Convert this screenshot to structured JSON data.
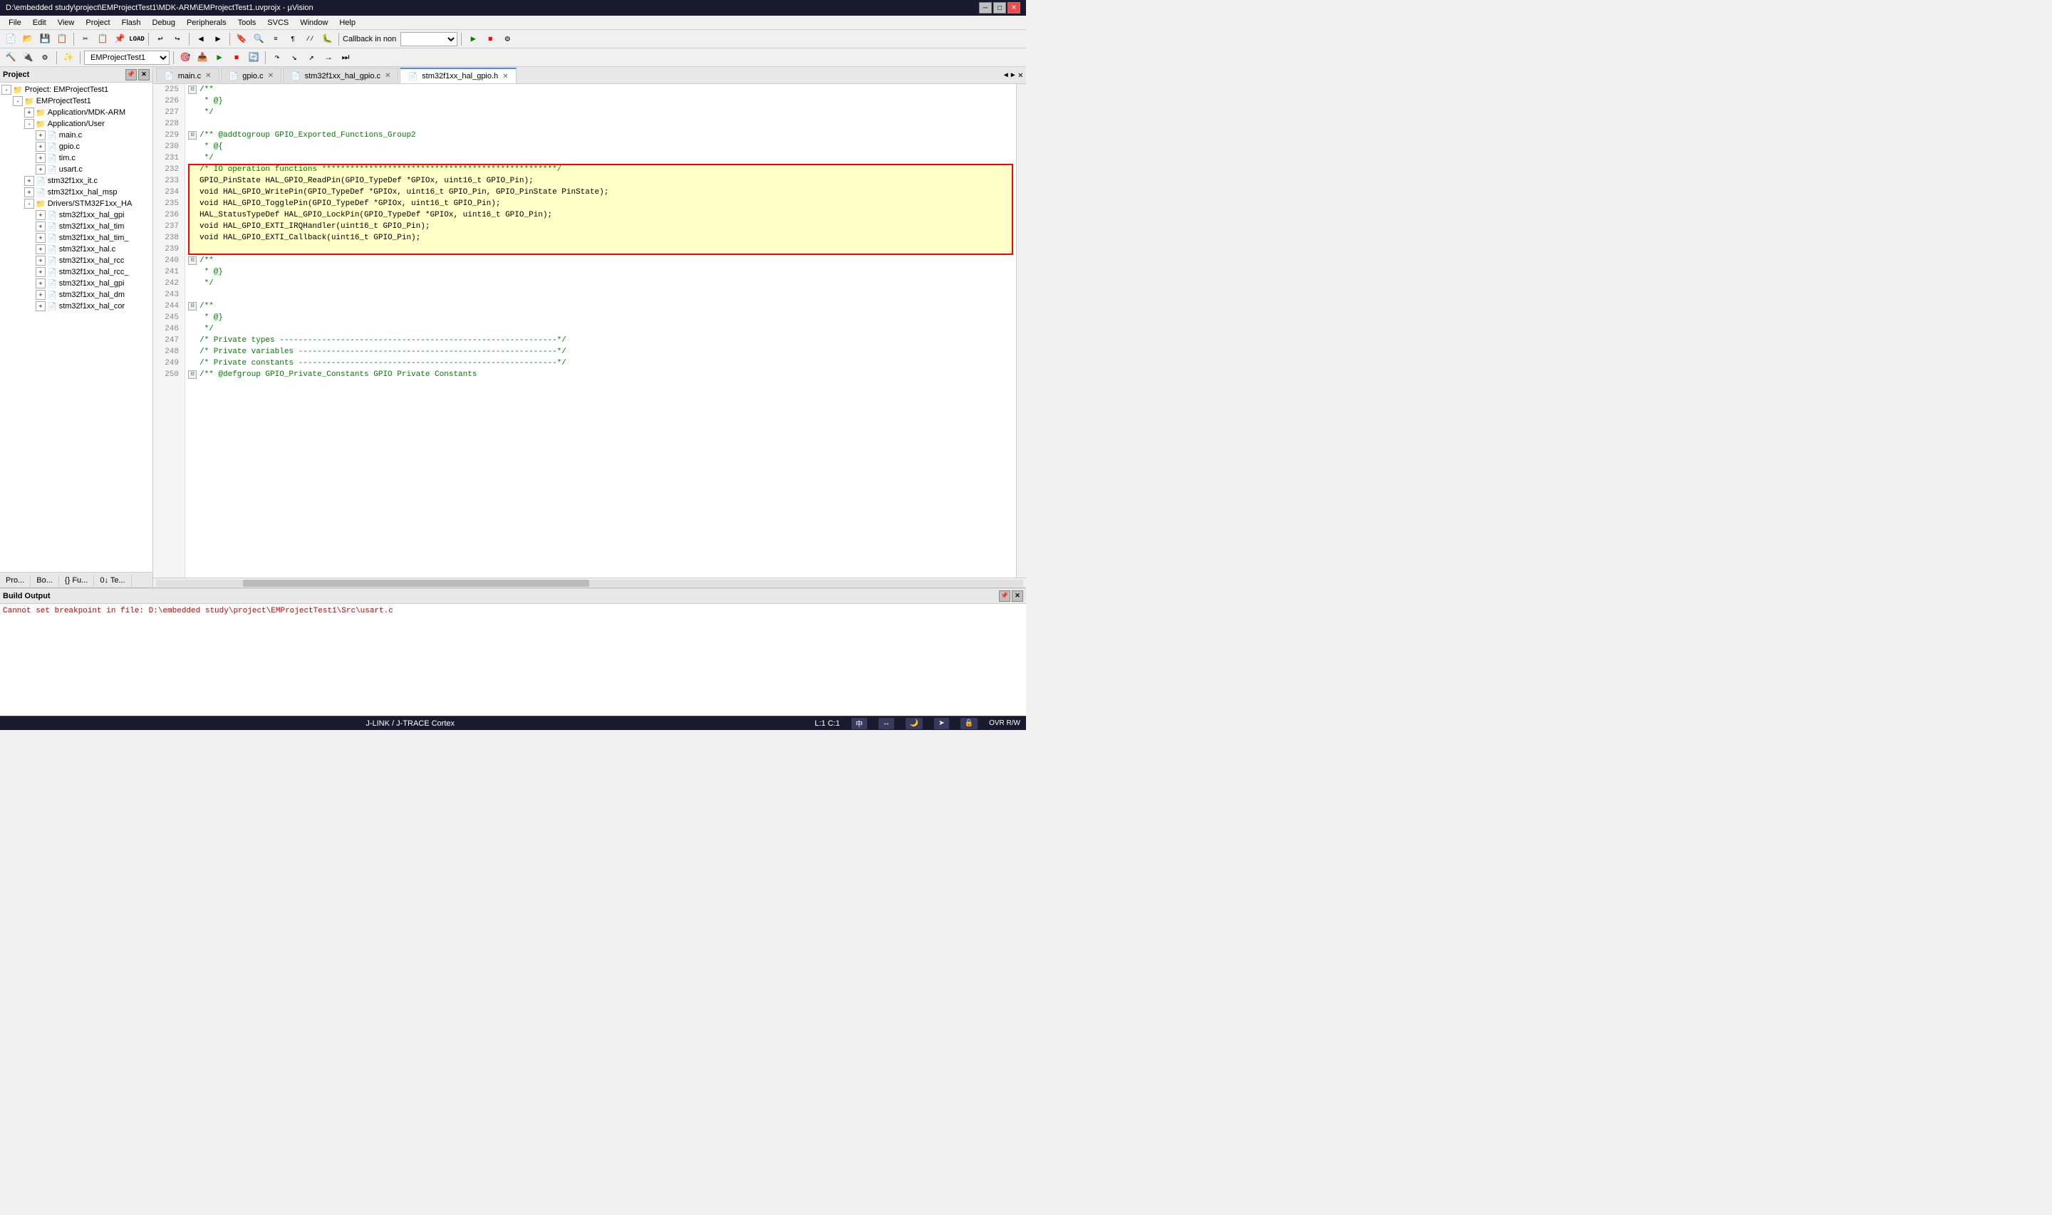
{
  "titleBar": {
    "title": "D:\\embedded study\\project\\EMProjectTest1\\MDK-ARM\\EMProjectTest1.uvprojx - µVision",
    "minBtn": "─",
    "maxBtn": "□",
    "closeBtn": "✕"
  },
  "menuBar": {
    "items": [
      "File",
      "Edit",
      "View",
      "Project",
      "Flash",
      "Debug",
      "Peripherals",
      "Tools",
      "SVCS",
      "Window",
      "Help"
    ]
  },
  "toolbar": {
    "projectName": "EMProjectTest1",
    "callbackLabel": "Callback in non"
  },
  "tabs": [
    {
      "label": "main.c",
      "active": false,
      "modified": true,
      "icon": "📄"
    },
    {
      "label": "gpio.c",
      "active": false,
      "modified": false,
      "icon": "📄"
    },
    {
      "label": "stm32f1xx_hal_gpio.c",
      "active": false,
      "modified": false,
      "icon": "📄"
    },
    {
      "label": "stm32f1xx_hal_gpio.h",
      "active": true,
      "modified": false,
      "icon": "📄"
    }
  ],
  "projectPanel": {
    "title": "Project",
    "tree": [
      {
        "level": 0,
        "toggle": "-",
        "icon": "📁",
        "label": "Project: EMProjectTest1"
      },
      {
        "level": 1,
        "toggle": "-",
        "icon": "📁",
        "label": "EMProjectTest1"
      },
      {
        "level": 2,
        "toggle": "+",
        "icon": "📁",
        "label": "Application/MDK-ARM"
      },
      {
        "level": 2,
        "toggle": "-",
        "icon": "📁",
        "label": "Application/User"
      },
      {
        "level": 3,
        "toggle": "+",
        "icon": "📄",
        "label": "main.c"
      },
      {
        "level": 3,
        "toggle": "+",
        "icon": "📄",
        "label": "gpio.c"
      },
      {
        "level": 3,
        "toggle": "+",
        "icon": "📄",
        "label": "tim.c"
      },
      {
        "level": 3,
        "toggle": "+",
        "icon": "📄",
        "label": "usart.c"
      },
      {
        "level": 2,
        "toggle": "+",
        "icon": "📄",
        "label": "stm32f1xx_it.c"
      },
      {
        "level": 2,
        "toggle": "+",
        "icon": "📄",
        "label": "stm32f1xx_hal_msp"
      },
      {
        "level": 2,
        "toggle": "-",
        "icon": "📁",
        "label": "Drivers/STM32F1xx_HA"
      },
      {
        "level": 3,
        "toggle": "+",
        "icon": "📄",
        "label": "stm32f1xx_hal_gpi"
      },
      {
        "level": 3,
        "toggle": "+",
        "icon": "📄",
        "label": "stm32f1xx_hal_tim"
      },
      {
        "level": 3,
        "toggle": "+",
        "icon": "📄",
        "label": "stm32f1xx_hal_tim_"
      },
      {
        "level": 3,
        "toggle": "+",
        "icon": "📄",
        "label": "stm32f1xx_hal.c"
      },
      {
        "level": 3,
        "toggle": "+",
        "icon": "📄",
        "label": "stm32f1xx_hal_rcc"
      },
      {
        "level": 3,
        "toggle": "+",
        "icon": "📄",
        "label": "stm32f1xx_hal_rcc_"
      },
      {
        "level": 3,
        "toggle": "+",
        "icon": "📄",
        "label": "stm32f1xx_hal_gpi"
      },
      {
        "level": 3,
        "toggle": "+",
        "icon": "📄",
        "label": "stm32f1xx_hal_dm"
      },
      {
        "level": 3,
        "toggle": "+",
        "icon": "📄",
        "label": "stm32f1xx_hal_cor"
      }
    ]
  },
  "codeLines": [
    {
      "num": 225,
      "fold": "⊟",
      "indent": 0,
      "content": "/**",
      "type": "comment"
    },
    {
      "num": 226,
      "fold": "",
      "indent": 0,
      "content": " * @}",
      "type": "comment"
    },
    {
      "num": 227,
      "fold": "",
      "indent": 0,
      "content": " */",
      "type": "comment"
    },
    {
      "num": 228,
      "fold": "",
      "indent": 0,
      "content": "",
      "type": "normal"
    },
    {
      "num": 229,
      "fold": "⊟",
      "indent": 0,
      "content": "/** @addtogroup GPIO_Exported_Functions_Group2",
      "type": "comment"
    },
    {
      "num": 230,
      "fold": "",
      "indent": 0,
      "content": " * @{",
      "type": "comment"
    },
    {
      "num": 231,
      "fold": "",
      "indent": 0,
      "content": " */",
      "type": "comment"
    },
    {
      "num": 232,
      "fold": "",
      "indent": 0,
      "content": "/* IO operation functions **************************************************/",
      "type": "highlight-comment"
    },
    {
      "num": 233,
      "fold": "",
      "indent": 0,
      "content": "GPIO_PinState HAL_GPIO_ReadPin(GPIO_TypeDef *GPIOx, uint16_t GPIO_Pin);",
      "type": "highlight-normal"
    },
    {
      "num": 234,
      "fold": "",
      "indent": 0,
      "content": "void HAL_GPIO_WritePin(GPIO_TypeDef *GPIOx, uint16_t GPIO_Pin, GPIO_PinState PinState);",
      "type": "highlight-normal"
    },
    {
      "num": 235,
      "fold": "",
      "indent": 0,
      "content": "void HAL_GPIO_TogglePin(GPIO_TypeDef *GPIOx, uint16_t GPIO_Pin);",
      "type": "highlight-normal"
    },
    {
      "num": 236,
      "fold": "",
      "indent": 0,
      "content": "HAL_StatusTypeDef HAL_GPIO_LockPin(GPIO_TypeDef *GPIOx, uint16_t GPIO_Pin);",
      "type": "highlight-normal"
    },
    {
      "num": 237,
      "fold": "",
      "indent": 0,
      "content": "void HAL_GPIO_EXTI_IRQHandler(uint16_t GPIO_Pin);",
      "type": "highlight-normal"
    },
    {
      "num": 238,
      "fold": "",
      "indent": 0,
      "content": "void HAL_GPIO_EXTI_Callback(uint16_t GPIO_Pin);",
      "type": "highlight-normal"
    },
    {
      "num": 239,
      "fold": "",
      "indent": 0,
      "content": "",
      "type": "highlight-empty"
    },
    {
      "num": 240,
      "fold": "⊟",
      "indent": 0,
      "content": "/**",
      "type": "comment"
    },
    {
      "num": 241,
      "fold": "",
      "indent": 0,
      "content": " * @}",
      "type": "comment"
    },
    {
      "num": 242,
      "fold": "",
      "indent": 0,
      "content": " */",
      "type": "comment"
    },
    {
      "num": 243,
      "fold": "",
      "indent": 0,
      "content": "",
      "type": "normal"
    },
    {
      "num": 244,
      "fold": "⊟",
      "indent": 0,
      "content": "/**",
      "type": "comment"
    },
    {
      "num": 245,
      "fold": "",
      "indent": 0,
      "content": " * @}",
      "type": "comment"
    },
    {
      "num": 246,
      "fold": "",
      "indent": 0,
      "content": " */",
      "type": "comment"
    },
    {
      "num": 247,
      "fold": "",
      "indent": 0,
      "content": "/* Private types -----------------------------------------------------------*/",
      "type": "green-comment"
    },
    {
      "num": 248,
      "fold": "",
      "indent": 0,
      "content": "/* Private variables -------------------------------------------------------*/",
      "type": "green-comment"
    },
    {
      "num": 249,
      "fold": "",
      "indent": 0,
      "content": "/* Private constants -------------------------------------------------------*/",
      "type": "green-comment"
    },
    {
      "num": 250,
      "fold": "⊟",
      "indent": 0,
      "content": "/** @defgroup GPIO_Private_Constants GPIO Private Constants",
      "type": "comment"
    }
  ],
  "buildOutput": {
    "title": "Build Output",
    "message": "Cannot set breakpoint in file: D:\\embedded study\\project\\EMProjectTest1\\Src\\usart.c"
  },
  "bottomTabs": [
    "Pro...",
    "Bo...",
    "{} Fu...",
    "0↓ Te..."
  ],
  "statusBar": {
    "left": "",
    "middle": "J-LINK / J-TRACE Cortex",
    "position": "L:1 C:1",
    "rightButtons": [
      "中",
      "↔",
      "🌙",
      "➤",
      "🔒"
    ],
    "encoding": "OVR R/W"
  }
}
